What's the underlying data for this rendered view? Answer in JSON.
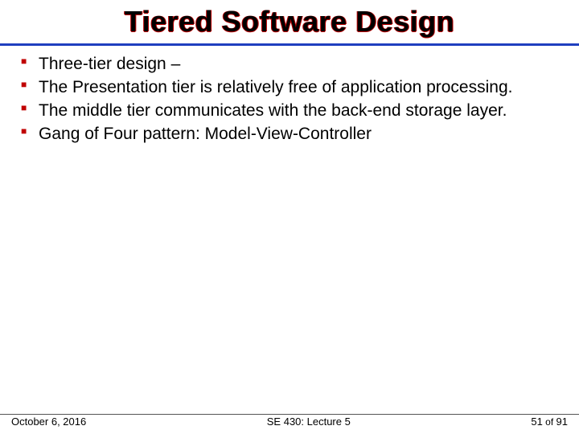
{
  "title": "Tiered Software Design",
  "bullets": [
    "Three-tier design –",
    "The Presentation tier is relatively free of application processing.",
    "The middle tier communicates with the back-end storage layer.",
    "Gang of Four pattern: Model-View-Controller"
  ],
  "footer": {
    "date": "October 6, 2016",
    "course": "SE 430: Lecture 5",
    "page_current": "51",
    "page_sep": " of ",
    "page_total": "91"
  }
}
